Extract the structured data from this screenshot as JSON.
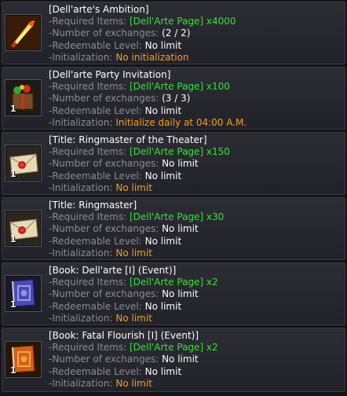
{
  "labels": {
    "required": "-Required Items: ",
    "exchanges": "-Number of exchanges: ",
    "level": "-Redeemable Level: ",
    "init": "-Initialization: "
  },
  "rows": [
    {
      "title": "[Dell'arte's Ambition]",
      "item": "[Dell'Arte Page] x4000",
      "exchanges": "(2 / 2)",
      "level": "No limit",
      "init": "No initialization",
      "qty": "",
      "icon": "flame-sword-icon"
    },
    {
      "title": "[Dell'arte Party Invitation]",
      "item": "[Dell'Arte Page] x100",
      "exchanges": "(3 / 3)",
      "level": "No limit",
      "init": "Initialize daily at 04:00 A.M.",
      "qty": "1",
      "icon": "party-box-icon"
    },
    {
      "title": "[Title: Ringmaster of the Theater]",
      "item": "[Dell'Arte Page] x150",
      "exchanges": "No limit",
      "level": "No limit",
      "init": "No limit",
      "qty": "1",
      "icon": "sealed-envelope-icon"
    },
    {
      "title": "[Title: Ringmaster]",
      "item": "[Dell'Arte Page] x30",
      "exchanges": "No limit",
      "level": "No limit",
      "init": "No limit",
      "qty": "1",
      "icon": "sealed-envelope-icon"
    },
    {
      "title": "[Book: Dell'arte [I] (Event)]",
      "item": "[Dell'Arte Page] x2",
      "exchanges": "No limit",
      "level": "No limit",
      "init": "No limit",
      "qty": "1",
      "icon": "blue-book-icon"
    },
    {
      "title": "[Book: Fatal Flourish [I] (Event)]",
      "item": "[Dell'Arte Page] x2",
      "exchanges": "No limit",
      "level": "No limit",
      "init": "No limit",
      "qty": "1",
      "icon": "orange-book-icon"
    }
  ]
}
